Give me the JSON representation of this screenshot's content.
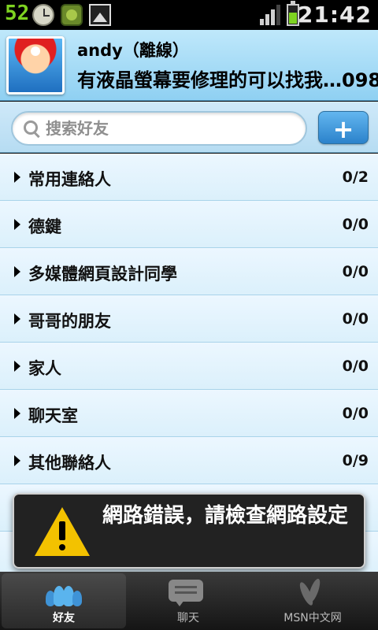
{
  "status_bar": {
    "notification_count": "52",
    "time": "21:42",
    "icons": [
      "clock-icon",
      "badge-icon",
      "image-icon",
      "signal-icon",
      "battery-icon"
    ],
    "battery_level": 0.6,
    "signal_bars": 3
  },
  "profile": {
    "name": "andy（離線）",
    "status_message": "有液晶螢幕要修理的可以找我…098"
  },
  "search": {
    "placeholder": "搜索好友",
    "value": "",
    "add_label": "+"
  },
  "groups": [
    {
      "label": "常用連絡人",
      "count": "0/2"
    },
    {
      "label": "德鍵",
      "count": "0/0"
    },
    {
      "label": "多媒體網頁設計同學",
      "count": "0/0"
    },
    {
      "label": "哥哥的朋友",
      "count": "0/0"
    },
    {
      "label": "家人",
      "count": "0/0"
    },
    {
      "label": "聊天室",
      "count": "0/0"
    },
    {
      "label": "其他聯絡人",
      "count": "0/9"
    },
    {
      "label": "",
      "count": ""
    },
    {
      "label": "",
      "count": ""
    }
  ],
  "toast": {
    "message": "網路錯誤，請檢查網路設定",
    "icon": "warning-icon"
  },
  "tabs": [
    {
      "label": "好友",
      "icon": "friends-icon",
      "active": true
    },
    {
      "label": "聊天",
      "icon": "chat-icon",
      "active": false
    },
    {
      "label": "MSN中文网",
      "icon": "msn-icon",
      "active": false
    }
  ],
  "colors": {
    "header_blue": "#8fd0f2",
    "accent_blue": "#2b82cb",
    "status_green": "#7ed321",
    "warning_yellow": "#f3c200"
  }
}
